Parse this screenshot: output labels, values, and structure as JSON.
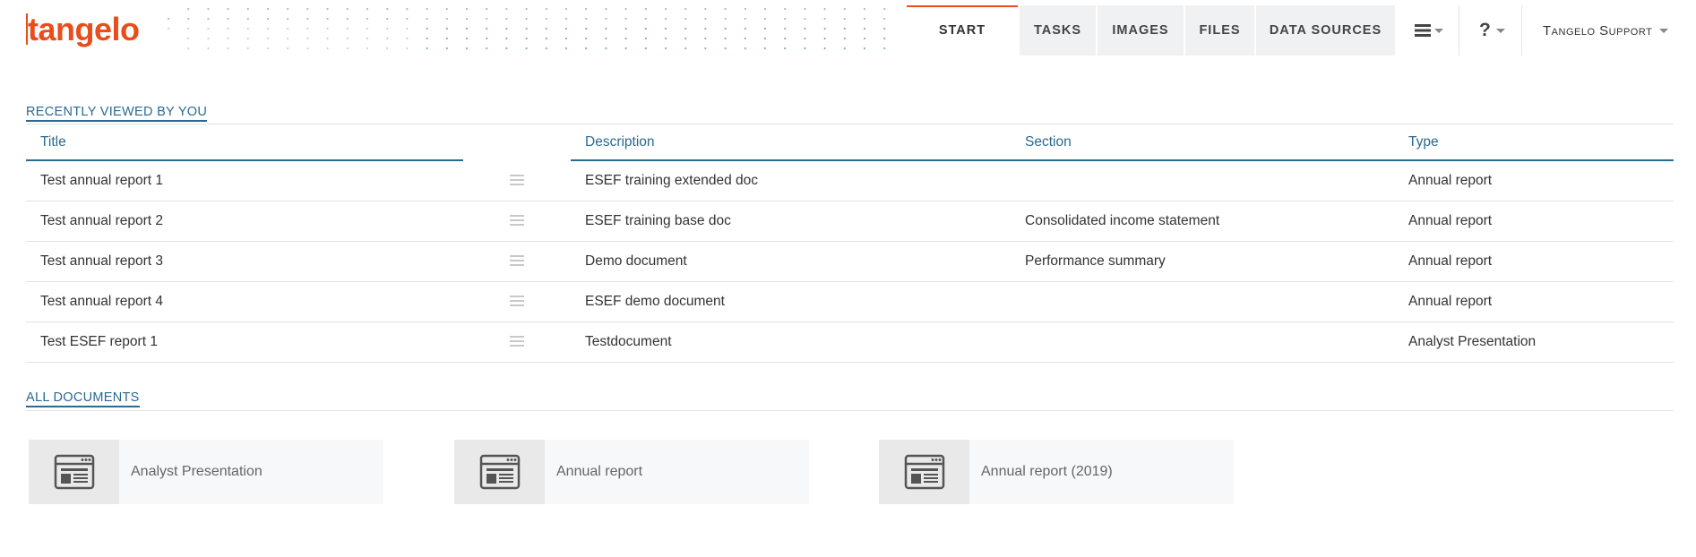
{
  "brand": {
    "logo_text": "tangelo",
    "accent_color": "#e84e1b",
    "link_color": "#2a6990"
  },
  "nav": {
    "tabs": [
      {
        "label": "START",
        "active": true
      },
      {
        "label": "TASKS",
        "active": false
      },
      {
        "label": "IMAGES",
        "active": false
      },
      {
        "label": "FILES",
        "active": false
      },
      {
        "label": "DATA SOURCES",
        "active": false
      }
    ],
    "menu_icon": "hamburger-menu-icon",
    "help_label": "?",
    "user_name": "Tangelo Support"
  },
  "recent": {
    "title": "RECENTLY VIEWED BY YOU",
    "columns": [
      "Title",
      "",
      "Description",
      "Section",
      "Type"
    ],
    "rows": [
      {
        "title": "Test annual report 1",
        "description": "ESEF training extended doc",
        "section": "",
        "type": "Annual report"
      },
      {
        "title": "Test annual report 2",
        "description": "ESEF training base doc",
        "section": "Consolidated income statement",
        "type": "Annual report"
      },
      {
        "title": "Test annual report 3",
        "description": "Demo document",
        "section": "Performance summary",
        "type": "Annual report"
      },
      {
        "title": "Test annual report 4",
        "description": "ESEF demo document",
        "section": "",
        "type": "Annual report"
      },
      {
        "title": "Test ESEF report 1",
        "description": "Testdocument",
        "section": "",
        "type": "Analyst Presentation"
      }
    ]
  },
  "all_documents": {
    "title": "ALL DOCUMENTS",
    "cards": [
      {
        "label": "Analyst Presentation",
        "icon": "document-layout-icon"
      },
      {
        "label": "Annual report",
        "icon": "document-layout-icon"
      },
      {
        "label": "Annual report (2019)",
        "icon": "document-layout-icon"
      }
    ]
  }
}
